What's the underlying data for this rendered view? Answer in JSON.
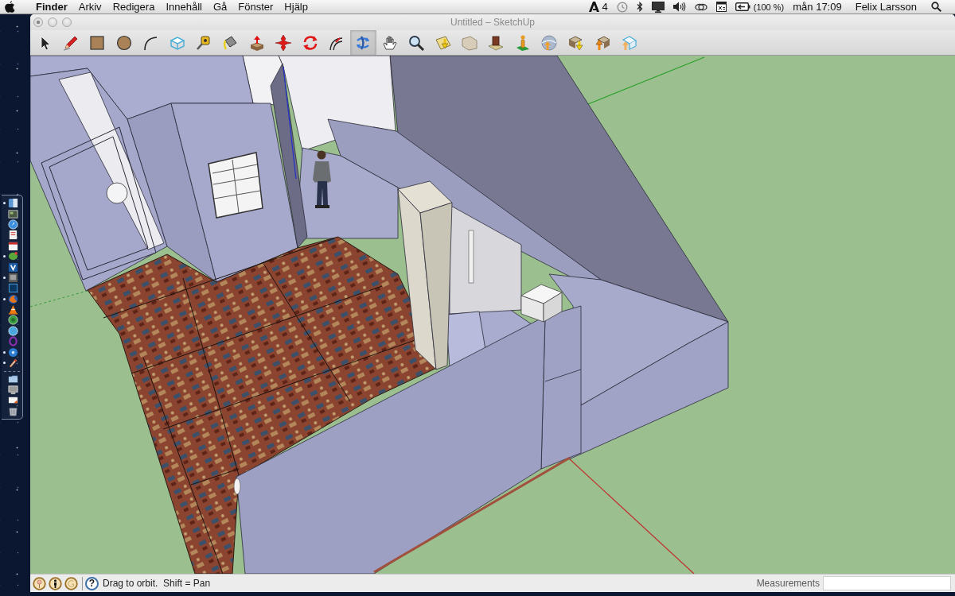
{
  "menu_bar": {
    "app_name": "Finder",
    "menus": [
      "Arkiv",
      "Redigera",
      "Innehåll",
      "Gå",
      "Fönster",
      "Hjälp"
    ],
    "status": {
      "badge_count": "4",
      "battery": "(100 %)",
      "clock": "mån 17:09",
      "user": "Felix Larsson"
    }
  },
  "dock": {
    "items": [
      {
        "running": true
      },
      {
        "running": false
      },
      {
        "running": false
      },
      {
        "running": false
      },
      {
        "running": false
      },
      {
        "running": true
      },
      {
        "running": false
      },
      {
        "running": true
      },
      {
        "running": false
      },
      {
        "running": true
      },
      {
        "running": false
      },
      {
        "running": false
      },
      {
        "running": false
      },
      {
        "running": false
      },
      {
        "running": true
      },
      {
        "running": true
      },
      {
        "running": false
      },
      {
        "running": false
      },
      {
        "running": false
      },
      {
        "running": false
      }
    ]
  },
  "window": {
    "title": "Untitled – SketchUp"
  },
  "toolbar": {
    "tools": [
      {
        "selected": false
      },
      {
        "selected": false
      },
      {
        "selected": false
      },
      {
        "selected": false
      },
      {
        "selected": false
      },
      {
        "selected": false
      },
      {
        "selected": false
      },
      {
        "selected": false
      },
      {
        "selected": false
      },
      {
        "selected": false
      },
      {
        "selected": false
      },
      {
        "selected": false
      },
      {
        "selected": true
      },
      {
        "selected": false
      },
      {
        "selected": false
      },
      {
        "selected": false
      },
      {
        "selected": false
      },
      {
        "selected": false
      },
      {
        "selected": false
      },
      {
        "selected": false
      },
      {
        "selected": false
      },
      {
        "selected": false
      },
      {
        "selected": false
      }
    ]
  },
  "status_bar": {
    "help_label": "?",
    "hint": "Drag to orbit.  Shift = Pan",
    "measurements_label": "Measurements"
  }
}
